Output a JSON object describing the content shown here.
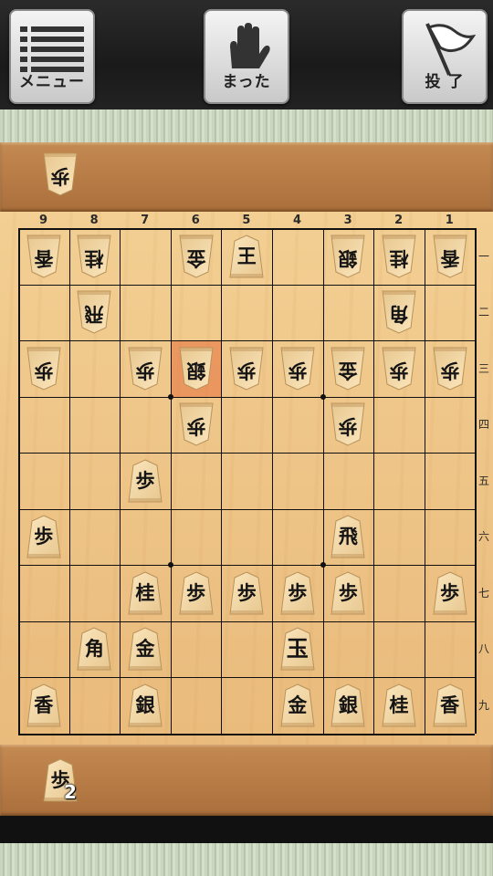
{
  "toolbar": {
    "menu_label": "メニュー",
    "undo_label": "まった",
    "resign_label": "投 了"
  },
  "board": {
    "file_numbers": [
      "9",
      "8",
      "7",
      "6",
      "5",
      "4",
      "3",
      "2",
      "1"
    ],
    "rank_numbers": [
      "一",
      "二",
      "三",
      "四",
      "五",
      "六",
      "七",
      "八",
      "九"
    ],
    "last_move_highlight": {
      "file": 6,
      "rank": 3
    },
    "pieces": [
      {
        "file": 9,
        "rank": 1,
        "char": "香",
        "side": "gote"
      },
      {
        "file": 8,
        "rank": 1,
        "char": "桂",
        "side": "gote"
      },
      {
        "file": 6,
        "rank": 1,
        "char": "金",
        "side": "gote"
      },
      {
        "file": 5,
        "rank": 1,
        "char": "王",
        "side": "gote",
        "upright": true
      },
      {
        "file": 3,
        "rank": 1,
        "char": "銀",
        "side": "gote"
      },
      {
        "file": 2,
        "rank": 1,
        "char": "桂",
        "side": "gote"
      },
      {
        "file": 1,
        "rank": 1,
        "char": "香",
        "side": "gote"
      },
      {
        "file": 8,
        "rank": 2,
        "char": "飛",
        "side": "gote"
      },
      {
        "file": 2,
        "rank": 2,
        "char": "角",
        "side": "gote"
      },
      {
        "file": 9,
        "rank": 3,
        "char": "歩",
        "side": "gote"
      },
      {
        "file": 7,
        "rank": 3,
        "char": "歩",
        "side": "gote"
      },
      {
        "file": 6,
        "rank": 3,
        "char": "銀",
        "side": "gote"
      },
      {
        "file": 5,
        "rank": 3,
        "char": "歩",
        "side": "gote"
      },
      {
        "file": 4,
        "rank": 3,
        "char": "歩",
        "side": "gote"
      },
      {
        "file": 3,
        "rank": 3,
        "char": "金",
        "side": "gote"
      },
      {
        "file": 2,
        "rank": 3,
        "char": "歩",
        "side": "gote"
      },
      {
        "file": 1,
        "rank": 3,
        "char": "歩",
        "side": "gote"
      },
      {
        "file": 6,
        "rank": 4,
        "char": "歩",
        "side": "gote"
      },
      {
        "file": 3,
        "rank": 4,
        "char": "歩",
        "side": "gote"
      },
      {
        "file": 7,
        "rank": 5,
        "char": "歩",
        "side": "sente"
      },
      {
        "file": 9,
        "rank": 6,
        "char": "歩",
        "side": "sente"
      },
      {
        "file": 3,
        "rank": 6,
        "char": "飛",
        "side": "sente"
      },
      {
        "file": 7,
        "rank": 7,
        "char": "桂",
        "side": "sente"
      },
      {
        "file": 6,
        "rank": 7,
        "char": "歩",
        "side": "sente"
      },
      {
        "file": 5,
        "rank": 7,
        "char": "歩",
        "side": "sente"
      },
      {
        "file": 4,
        "rank": 7,
        "char": "歩",
        "side": "sente"
      },
      {
        "file": 3,
        "rank": 7,
        "char": "歩",
        "side": "sente"
      },
      {
        "file": 1,
        "rank": 7,
        "char": "歩",
        "side": "sente"
      },
      {
        "file": 8,
        "rank": 8,
        "char": "角",
        "side": "sente"
      },
      {
        "file": 7,
        "rank": 8,
        "char": "金",
        "side": "sente"
      },
      {
        "file": 4,
        "rank": 8,
        "char": "玉",
        "side": "sente",
        "king": true
      },
      {
        "file": 9,
        "rank": 9,
        "char": "香",
        "side": "sente"
      },
      {
        "file": 7,
        "rank": 9,
        "char": "銀",
        "side": "sente"
      },
      {
        "file": 4,
        "rank": 9,
        "char": "金",
        "side": "sente"
      },
      {
        "file": 3,
        "rank": 9,
        "char": "銀",
        "side": "sente"
      },
      {
        "file": 2,
        "rank": 9,
        "char": "桂",
        "side": "sente"
      },
      {
        "file": 1,
        "rank": 9,
        "char": "香",
        "side": "sente"
      }
    ]
  },
  "gote_hand": {
    "pieces": [
      {
        "char": "歩",
        "count": ""
      }
    ]
  },
  "sente_hand": {
    "pieces": [
      {
        "char": "歩",
        "count": "2"
      }
    ]
  },
  "icons": {
    "menu": "menu-lines-icon",
    "undo": "hand-stop-icon",
    "resign": "white-flag-icon"
  }
}
